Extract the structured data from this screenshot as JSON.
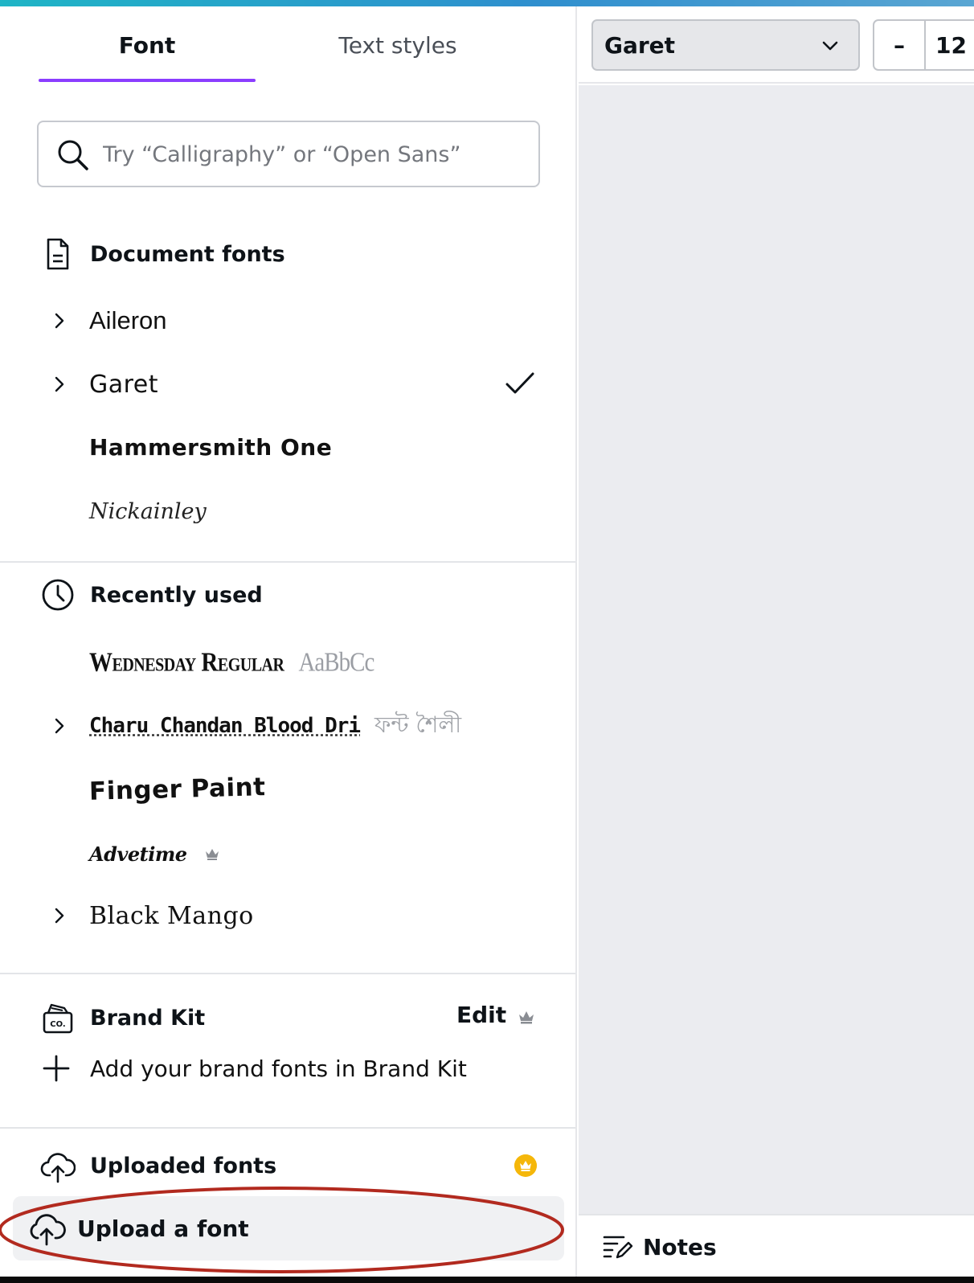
{
  "tabs": {
    "font": "Font",
    "text_styles": "Text styles"
  },
  "search": {
    "placeholder": "Try “Calligraphy” or “Open Sans”",
    "value": ""
  },
  "document_fonts": {
    "title": "Document fonts",
    "items": [
      {
        "name": "Aileron",
        "expandable": true
      },
      {
        "name": "Garet",
        "expandable": true,
        "selected": true
      },
      {
        "name": "Hammersmith One",
        "expandable": false
      },
      {
        "name": "Nickainley",
        "expandable": false
      }
    ]
  },
  "recently_used": {
    "title": "Recently used",
    "items": [
      {
        "name": "Wednesday Regular",
        "sample": "AaBbCc",
        "expandable": false
      },
      {
        "name": "Charu Chandan Blood Dri",
        "sample": "ফন্ট শৈলী",
        "expandable": true
      },
      {
        "name": "Finger Paint",
        "expandable": false
      },
      {
        "name": "Advetime",
        "expandable": false,
        "premium": true
      },
      {
        "name": "Black Mango",
        "expandable": true
      }
    ]
  },
  "brand_kit": {
    "title": "Brand Kit",
    "edit_label": "Edit",
    "add_label": "Add your brand fonts in Brand Kit"
  },
  "uploaded_fonts": {
    "title": "Uploaded fonts",
    "upload_button": "Upload a font"
  },
  "toolbar": {
    "font_value": "Garet",
    "size_minus": "–",
    "size_value": "12"
  },
  "notes": {
    "label": "Notes"
  },
  "colors": {
    "accent": "#8b3dff",
    "highlight": "#b22a1f",
    "crown_gold": "#f5b70a"
  }
}
